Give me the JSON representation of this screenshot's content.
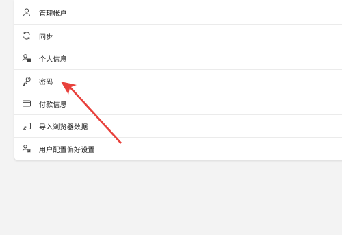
{
  "settings": {
    "items": [
      {
        "label": "管理帐户",
        "icon": "person-icon"
      },
      {
        "label": "同步",
        "icon": "sync-icon"
      },
      {
        "label": "个人信息",
        "icon": "person-card-icon"
      },
      {
        "label": "密码",
        "icon": "key-icon"
      },
      {
        "label": "付款信息",
        "icon": "card-icon"
      },
      {
        "label": "导入浏览器数据",
        "icon": "import-icon"
      },
      {
        "label": "用户配置偏好设置",
        "icon": "person-settings-icon"
      }
    ]
  },
  "colors": {
    "background": "#f3f3f3",
    "panel": "#ffffff",
    "annotation_arrow": "#e8413c"
  }
}
